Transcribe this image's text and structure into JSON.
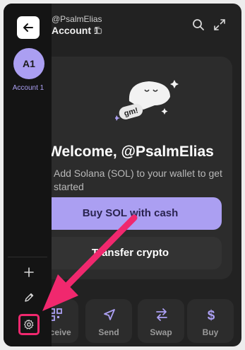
{
  "header": {
    "handle": "@PsalmElias",
    "account": "Account 1"
  },
  "sidebar": {
    "avatar_initials": "A1",
    "account_name": "Account 1"
  },
  "welcome": {
    "title": "Welcome, @PsalmElias",
    "subtitle": "Add Solana (SOL) to your wallet to get started",
    "sticker_text": "gm!"
  },
  "buttons": {
    "buy_sol": "Buy SOL with cash",
    "transfer": "Transfer crypto"
  },
  "actions": [
    {
      "label": "Receive",
      "icon": "qr-icon"
    },
    {
      "label": "Send",
      "icon": "send-icon"
    },
    {
      "label": "Swap",
      "icon": "swap-icon"
    },
    {
      "label": "Buy",
      "icon": "dollar-icon"
    }
  ],
  "colors": {
    "accent": "#ab9ff2",
    "annotation": "#f0286e",
    "background": "#222222",
    "sidebar": "#141414"
  }
}
